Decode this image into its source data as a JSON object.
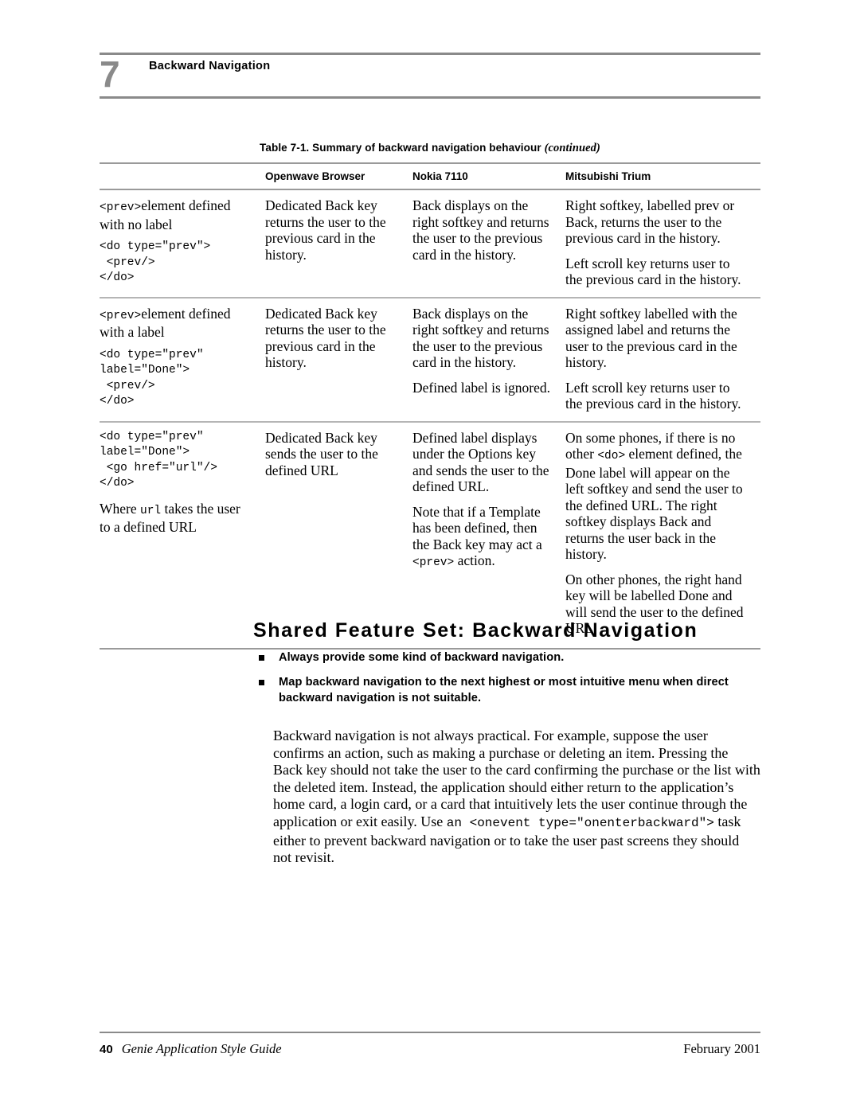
{
  "header": {
    "chapter_number": "7",
    "title": "Backward Navigation"
  },
  "table": {
    "caption_main": "Table 7-1.  Summary of backward navigation behaviour",
    "caption_continued": "(continued)",
    "columns": [
      {
        "label": ""
      },
      {
        "label": "Openwave Browser"
      },
      {
        "label": "Nokia 7110"
      },
      {
        "label": "Mitsubishi Trium"
      }
    ],
    "rows": [
      {
        "feature_text": "element defined with no label",
        "feature_inline_code": "<prev>",
        "feature_code": "<do type=\"prev\">\n <prev/>\n</do>",
        "openwave": "Dedicated Back key returns the user to the previous card in the history.",
        "nokia": "Back displays on the right softkey and returns the user to the previous card in the history.",
        "trium_p1": "Right softkey, labelled prev or Back, returns the user to the previous card in the history.",
        "trium_p2": "Left scroll key returns user to the previous card in the history."
      },
      {
        "feature_text": "element defined with a label",
        "feature_inline_code": "<prev>",
        "feature_code": "<do type=\"prev\"\nlabel=\"Done\">\n <prev/>\n</do>",
        "openwave": "Dedicated Back key returns the user to the previous card in the history.",
        "nokia_p1": "Back displays on the right softkey and returns the user to the previous card in the history.",
        "nokia_p2": "Defined label is ignored.",
        "trium_p1": "Right softkey labelled with the assigned label and returns the user to the previous card in the history.",
        "trium_p2": "Left scroll key returns user to the previous card in the history."
      },
      {
        "feature_code": "<do type=\"prev\"\nlabel=\"Done\">\n <go href=\"url\"/>\n</do>",
        "feature_note_pre": "Where ",
        "feature_note_code": "url",
        "feature_note_post": " takes the user to a defined URL",
        "openwave": "Dedicated Back key sends the user to the defined URL",
        "nokia_p1": "Defined label displays under the Options key and sends the user to the defined URL.",
        "nokia_p2_pre": "Note that if a Template has been defined, then the Back key may act a ",
        "nokia_p2_code": "<prev>",
        "nokia_p2_post": " action.",
        "trium_p1_pre": "On some phones, if there is no other ",
        "trium_p1_code": "<do>",
        "trium_p1_post": " element defined, the Done label will appear on the left softkey and send the user to the defined URL. The right softkey displays Back and returns the user back in the history.",
        "trium_p2": "On other phones, the right hand key will be labelled Done and will send the user to the defined URL."
      }
    ]
  },
  "section": {
    "heading": "Shared Feature Set: Backward Navigation",
    "bullets": [
      "Always provide some kind of backward navigation.",
      "Map backward navigation to the next highest or most intuitive menu when direct backward navigation is not suitable."
    ],
    "paragraph_part1": "Backward navigation is not always practical. For example, suppose the user confirms an action, such as making a purchase or deleting an item. Pressing the Back key should not take the user to the card confirming the purchase or the list with the deleted item. Instead, the application should either return to the application’s home card, a login card, or a card that intuitively lets the user continue through the application or exit easily. Use ",
    "paragraph_code": "an <onevent type=\"onenterbackward\">",
    "paragraph_part2": " task either to prevent backward navigation or to take the user past screens they should not revisit."
  },
  "footer": {
    "page_number": "40",
    "document_title": "Genie Application Style Guide",
    "date": "February 2001"
  }
}
